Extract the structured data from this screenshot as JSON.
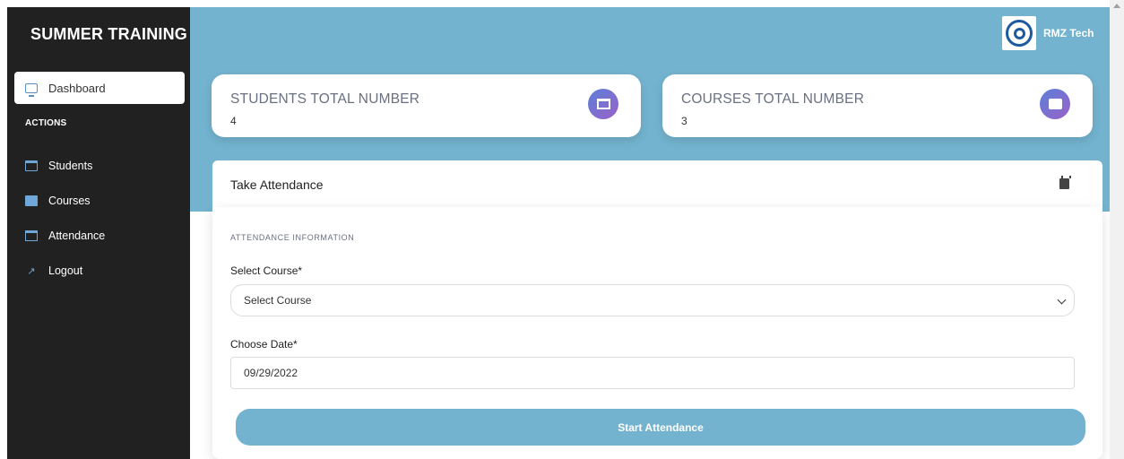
{
  "sidebar": {
    "brand": "SUMMER TRAINING",
    "active_item": "Dashboard",
    "actions_heading": "ACTIONS",
    "items": [
      {
        "label": "Students",
        "icon": "students-icon"
      },
      {
        "label": "Courses",
        "icon": "book-icon"
      },
      {
        "label": "Attendance",
        "icon": "calendar-icon"
      },
      {
        "label": "Logout",
        "icon": "running-icon"
      }
    ]
  },
  "header": {
    "company": "RMZ Tech"
  },
  "stats": [
    {
      "title": "STUDENTS TOTAL NUMBER",
      "value": "4",
      "icon": "students-icon"
    },
    {
      "title": "COURSES TOTAL NUMBER",
      "value": "3",
      "icon": "book-icon"
    }
  ],
  "attendance": {
    "title": "Take Attendance",
    "section": "ATTENDANCE INFORMATION",
    "course_label": "Select Course*",
    "course_value": "Select Course",
    "date_label": "Choose Date*",
    "date_value": "09/29/2022",
    "button": "Start Attendance"
  },
  "colors": {
    "sidebar": "#212121",
    "hero": "#73b3cf",
    "accent_gradient_start": "#5b7fd8",
    "accent_gradient_end": "#9a62c9"
  }
}
